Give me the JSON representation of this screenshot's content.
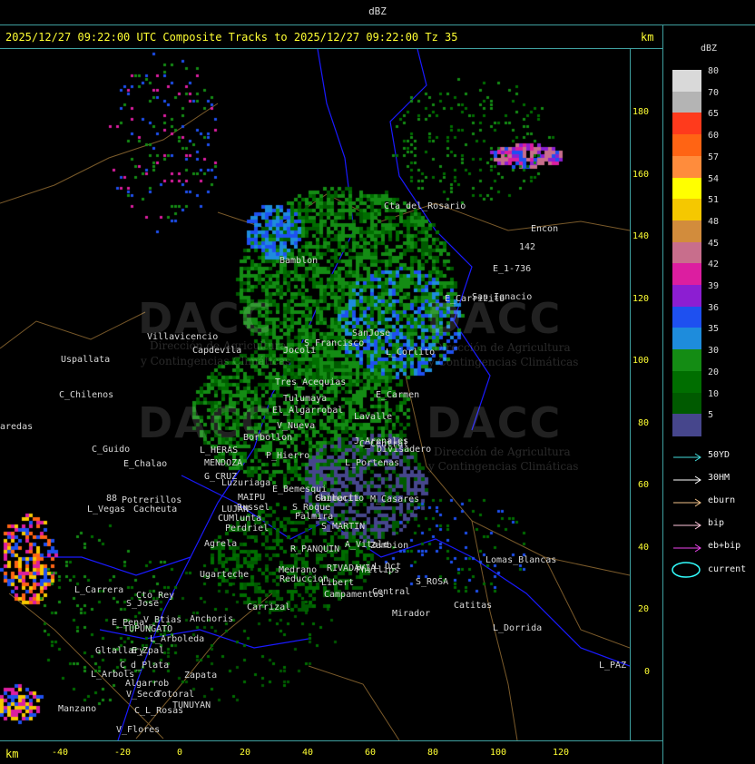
{
  "window": {
    "title": "dBZ"
  },
  "header": {
    "title": "2025/12/27 09:22:00 UTC Composite Tracks to 2025/12/27 09:22:00 Tz 35",
    "km_label_top": "km",
    "km_label_bottom": "km"
  },
  "axes": {
    "y_ticks": [
      "180",
      "160",
      "140",
      "120",
      "100",
      "80",
      "60",
      "40",
      "20",
      "0"
    ],
    "x_ticks": [
      "-40",
      "-20",
      "0",
      "20",
      "40",
      "60",
      "80",
      "100",
      "120"
    ]
  },
  "watermark": {
    "name": "DACC",
    "subtitle_1": "Dirección de Agricultura",
    "subtitle_2": "y Contingencias Climáticas"
  },
  "places": [
    "Cta_del_Rosario",
    "Encon",
    "E_1-736",
    "142",
    "Bamblon",
    "San_Ignacio",
    "E_Carrizito",
    "Villavicencio",
    "Capdevila",
    "Jocoli",
    "S_Francisco",
    "SanJose",
    "L_Corlito",
    "Uspallata",
    "Tres_Acequias",
    "Tulumaya",
    "E_Carmen",
    "C_Chilenos",
    "El_Algarrobal",
    "V_Nueva",
    "Lavalle",
    "Borbollon",
    "C_Central",
    "Divisadero",
    "C_Guido",
    "L_HERAS",
    "P_Hierro",
    "J_Arenales",
    "E_Chalao",
    "MENDOZA",
    "L_Portenas",
    "G_CRUZ",
    "Luzuriaga",
    "E_Bemesqui",
    "Sanmarti",
    "Potrerillos",
    "MAIPU",
    "Russel",
    "Chilecito",
    "M_Casares",
    "L_Vegas",
    "Cacheuta",
    "LUJAN",
    "CUMlunta",
    "S_Roque",
    "Palmira",
    "Perdriel",
    "S_MARTIN",
    "Agrela",
    "A_Vitale",
    "Zambion",
    "R_PANQUIN",
    "Ugarteche",
    "Medrano",
    "Reduccion",
    "RIVADAVIA",
    "Phillips",
    "L_Oct",
    "S_ROSA",
    "Lomas_Blancas",
    "L_Carrera",
    "Cto_Rey",
    "S_Jose",
    "Carrizal",
    "Libert",
    "Campamentos",
    "Central",
    "Catitas",
    "E_Pena",
    "V_Btias",
    "Anchoris",
    "TUPUNGATO",
    "Mirador",
    "L_Dorrida",
    "L_Arboleda",
    "E_Zpal",
    "Gltallary",
    "C_d_Plata",
    "L_Arbols",
    "Zapata",
    "Algarrob",
    "V_Seco",
    "Totoral",
    "TUNUYAN",
    "L_PAZ",
    "Manzano",
    "C_L_Rosas",
    "V_Flores",
    "aredas",
    "88"
  ],
  "legend": {
    "title": "dBZ",
    "bins": [
      {
        "label": "80",
        "color": "#d9d9d9"
      },
      {
        "label": "70",
        "color": "#b4b4b4"
      },
      {
        "label": "65",
        "color": "#ff3a1c"
      },
      {
        "label": "60",
        "color": "#ff6414"
      },
      {
        "label": "57",
        "color": "#ff8c3c"
      },
      {
        "label": "54",
        "color": "#ffff00"
      },
      {
        "label": "51",
        "color": "#f5c800"
      },
      {
        "label": "48",
        "color": "#d28c3c"
      },
      {
        "label": "45",
        "color": "#c86e8c"
      },
      {
        "label": "42",
        "color": "#dc1ea0"
      },
      {
        "label": "39",
        "color": "#8c1ed2"
      },
      {
        "label": "36",
        "color": "#1e50f0"
      },
      {
        "label": "35",
        "color": "#1e8cdc"
      },
      {
        "label": "30",
        "color": "#148c14"
      },
      {
        "label": "20",
        "color": "#006e00"
      },
      {
        "label": "10",
        "color": "#005a00"
      },
      {
        "label": "5",
        "color": "#46468c"
      }
    ]
  },
  "tracks": [
    {
      "label": "50YD",
      "color": "#44dddd"
    },
    {
      "label": "30HM",
      "color": "#ffffff"
    },
    {
      "label": "eburn",
      "color": "#f2c28a"
    },
    {
      "label": "bip",
      "color": "#ffc8dc"
    },
    {
      "label": "eb+bip",
      "color": "#ee44ee"
    }
  ],
  "current": {
    "label": "current",
    "color": "#33ffff"
  },
  "colors": {
    "frame": "#3fa0a0",
    "title": "#ffff33",
    "border_blue": "#1a1aff",
    "border_road": "#7a5a2a"
  }
}
